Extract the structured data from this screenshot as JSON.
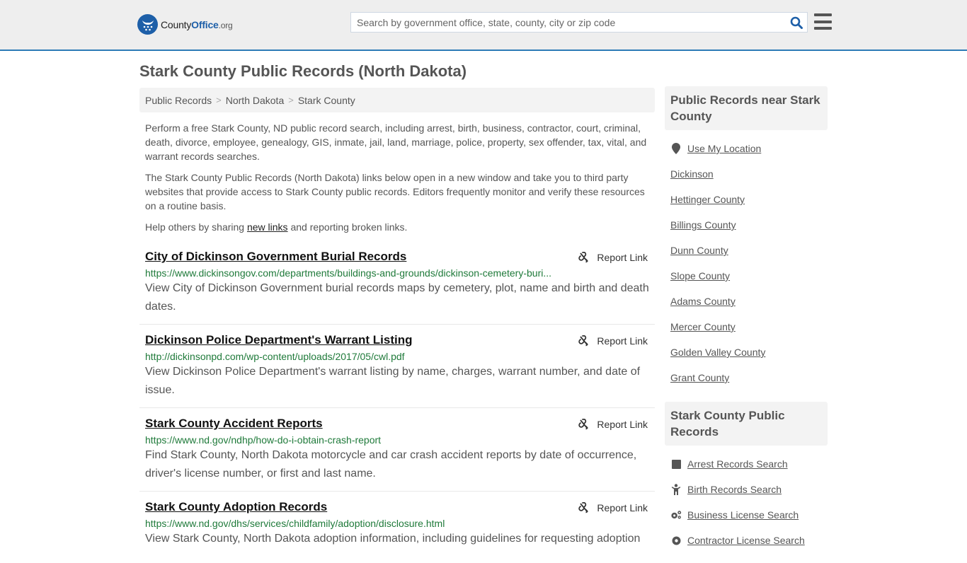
{
  "header": {
    "logo": {
      "name_part1": "County",
      "name_part2": "Office",
      "name_part3": ".org"
    },
    "search": {
      "placeholder": "Search by government office, state, county, city or zip code",
      "value": ""
    },
    "accent_color": "#2d7bb6"
  },
  "page": {
    "title": "Stark County Public Records (North Dakota)"
  },
  "breadcrumb": [
    {
      "label": "Public Records"
    },
    {
      "label": "North Dakota"
    },
    {
      "label": "Stark County"
    }
  ],
  "breadcrumb_separator": ">",
  "intro": {
    "p1": "Perform a free Stark County, ND public record search, including arrest, birth, business, contractor, court, criminal, death, divorce, employee, genealogy, GIS, inmate, jail, land, marriage, police, property, sex offender, tax, vital, and warrant records searches.",
    "p2": "The Stark County Public Records (North Dakota) links below open in a new window and take you to third party websites that provide access to Stark County public records. Editors frequently monitor and verify these resources on a routine basis.",
    "p3_before": "Help others by sharing ",
    "p3_link": "new links",
    "p3_after": " and reporting broken links."
  },
  "report_label": "Report Link",
  "results": [
    {
      "title": "City of Dickinson Government Burial Records",
      "url": "https://www.dickinsongov.com/departments/buildings-and-grounds/dickinson-cemetery-buri...",
      "description": "View City of Dickinson Government burial records maps by cemetery, plot, name and birth and death dates."
    },
    {
      "title": "Dickinson Police Department's Warrant Listing",
      "url": "http://dickinsonpd.com/wp-content/uploads/2017/05/cwl.pdf",
      "description": "View Dickinson Police Department's warrant listing by name, charges, warrant number, and date of issue."
    },
    {
      "title": "Stark County Accident Reports",
      "url": "https://www.nd.gov/ndhp/how-do-i-obtain-crash-report",
      "description": "Find Stark County, North Dakota motorcycle and car crash accident reports by date of occurrence, driver's license number, or first and last name."
    },
    {
      "title": "Stark County Adoption Records",
      "url": "https://www.nd.gov/dhs/services/childfamily/adoption/disclosure.html",
      "description": "View Stark County, North Dakota adoption information, including guidelines for requesting adoption"
    }
  ],
  "sidebar": {
    "nearby_heading": "Public Records near Stark County",
    "use_location": "Use My Location",
    "nearby": [
      "Dickinson",
      "Hettinger County",
      "Billings County",
      "Dunn County",
      "Slope County",
      "Adams County",
      "Mercer County",
      "Golden Valley County",
      "Grant County"
    ],
    "records_heading": "Stark County Public Records",
    "records": [
      {
        "label": "Arrest Records Search",
        "icon": "square-icon"
      },
      {
        "label": "Birth Records Search",
        "icon": "child-icon"
      },
      {
        "label": "Business License Search",
        "icon": "gears-icon"
      },
      {
        "label": "Contractor License Search",
        "icon": "gear-icon"
      }
    ]
  }
}
